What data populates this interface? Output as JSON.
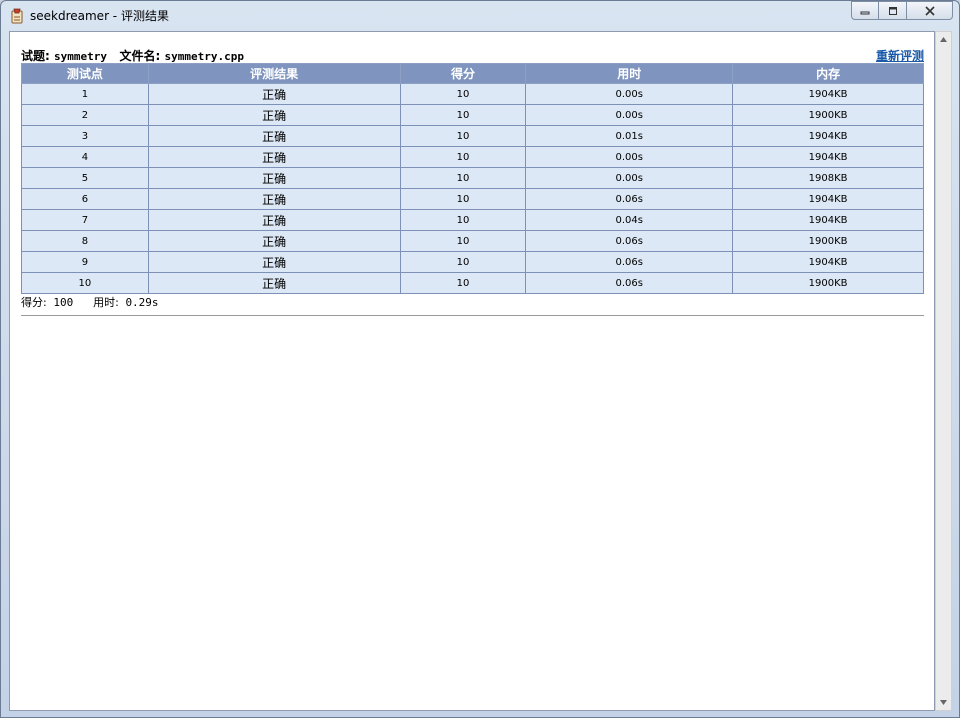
{
  "window": {
    "title": "seekdreamer - 评测结果"
  },
  "header": {
    "problem_label": "试题:",
    "problem_name": "symmetry",
    "file_label": "文件名:",
    "file_name": "symmetry.cpp",
    "rejudge": "重新评测"
  },
  "table": {
    "columns": [
      "测试点",
      "评测结果",
      "得分",
      "用时",
      "内存"
    ],
    "rows": [
      [
        "1",
        "正确",
        "10",
        "0.00s",
        "1904KB"
      ],
      [
        "2",
        "正确",
        "10",
        "0.00s",
        "1900KB"
      ],
      [
        "3",
        "正确",
        "10",
        "0.01s",
        "1904KB"
      ],
      [
        "4",
        "正确",
        "10",
        "0.00s",
        "1904KB"
      ],
      [
        "5",
        "正确",
        "10",
        "0.00s",
        "1908KB"
      ],
      [
        "6",
        "正确",
        "10",
        "0.06s",
        "1904KB"
      ],
      [
        "7",
        "正确",
        "10",
        "0.04s",
        "1904KB"
      ],
      [
        "8",
        "正确",
        "10",
        "0.06s",
        "1900KB"
      ],
      [
        "9",
        "正确",
        "10",
        "0.06s",
        "1904KB"
      ],
      [
        "10",
        "正确",
        "10",
        "0.06s",
        "1900KB"
      ]
    ]
  },
  "summary": {
    "score_label": "得分:",
    "score": "100",
    "time_label": "用时:",
    "time": "0.29s"
  },
  "icons": {
    "app": "app-icon",
    "minimize": "minimize-icon",
    "maximize": "maximize-icon",
    "close": "close-icon"
  },
  "colors": {
    "header_bg": "#7f95bf",
    "row_bg": "#dce8f5",
    "link": "#1a5aa8"
  }
}
